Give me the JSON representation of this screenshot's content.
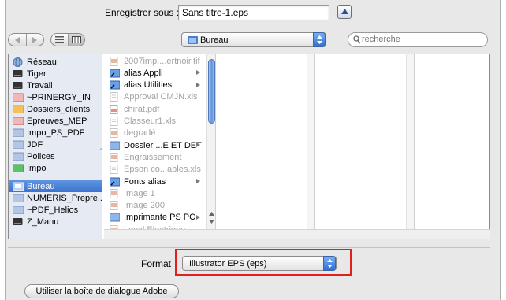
{
  "save_as": {
    "label": "Enregistrer sous :",
    "filename": "Sans titre-1.eps"
  },
  "toolbar": {
    "location": "Bureau",
    "search_placeholder": "recherche"
  },
  "sidebar": {
    "items": [
      {
        "label": "Réseau",
        "icon": "network-globe-icon"
      },
      {
        "label": "Tiger",
        "icon": "hard-drive-icon"
      },
      {
        "label": "Travail",
        "icon": "hard-drive-icon"
      },
      {
        "label": "~PRINERGY_IN",
        "icon": "red-folder-icon"
      },
      {
        "label": "Dossiers_clients",
        "icon": "orange-folder-icon"
      },
      {
        "label": "Epreuves_MEP",
        "icon": "red-folder-icon"
      },
      {
        "label": "Impo_PS_PDF",
        "icon": "folder-icon"
      },
      {
        "label": "JDF",
        "icon": "folder-icon"
      },
      {
        "label": "Polices",
        "icon": "folder-icon"
      },
      {
        "label": "Impo",
        "icon": "green-folder-icon"
      },
      {
        "label": "Bureau",
        "icon": "desktop-icon",
        "selected": true
      },
      {
        "label": "NUMERIS_Prepre...",
        "icon": "folder-icon"
      },
      {
        "label": "~PDF_Helios",
        "icon": "folder-icon"
      },
      {
        "label": "Z_Manu",
        "icon": "hard-drive-icon"
      }
    ]
  },
  "files": [
    {
      "label": "2007imp....ertnoir.tif",
      "dim": true,
      "arrow": false,
      "icon": "image-file-icon"
    },
    {
      "label": "alias Appli",
      "dim": false,
      "arrow": true,
      "icon": "alias-folder-icon"
    },
    {
      "label": "alias Utilities",
      "dim": false,
      "arrow": true,
      "icon": "alias-folder-icon"
    },
    {
      "label": "Approval CMJN.xls",
      "dim": true,
      "arrow": false,
      "icon": "document-icon"
    },
    {
      "label": "chirat.pdf",
      "dim": true,
      "arrow": false,
      "icon": "pdf-file-icon"
    },
    {
      "label": "Classeur1.xls",
      "dim": true,
      "arrow": false,
      "icon": "document-icon"
    },
    {
      "label": "degradé",
      "dim": true,
      "arrow": false,
      "icon": "image-file-icon"
    },
    {
      "label": "Dossier ...E ET DET",
      "dim": false,
      "arrow": true,
      "icon": "folder-icon"
    },
    {
      "label": "Engraissement",
      "dim": true,
      "arrow": false,
      "icon": "image-file-icon"
    },
    {
      "label": "Epson co...ables.xls",
      "dim": true,
      "arrow": false,
      "icon": "document-icon"
    },
    {
      "label": "Fonts alias",
      "dim": false,
      "arrow": true,
      "icon": "alias-folder-icon"
    },
    {
      "label": "Image 1",
      "dim": true,
      "arrow": false,
      "icon": "image-file-icon"
    },
    {
      "label": "Image 200",
      "dim": true,
      "arrow": false,
      "icon": "image-file-icon"
    },
    {
      "label": "Imprimante PS PC",
      "dim": false,
      "arrow": true,
      "icon": "folder-icon"
    },
    {
      "label": "Local Electrique",
      "dim": true,
      "arrow": false,
      "icon": "image-file-icon"
    }
  ],
  "format": {
    "label": "Format",
    "value": "Illustrator EPS (eps)"
  },
  "adobe_button": "Utiliser la boîte de dialogue Adobe",
  "colors": {
    "selection": "#3a72cf",
    "highlight": "#e01f1f",
    "popup_arrow": "#2d6fd6"
  }
}
